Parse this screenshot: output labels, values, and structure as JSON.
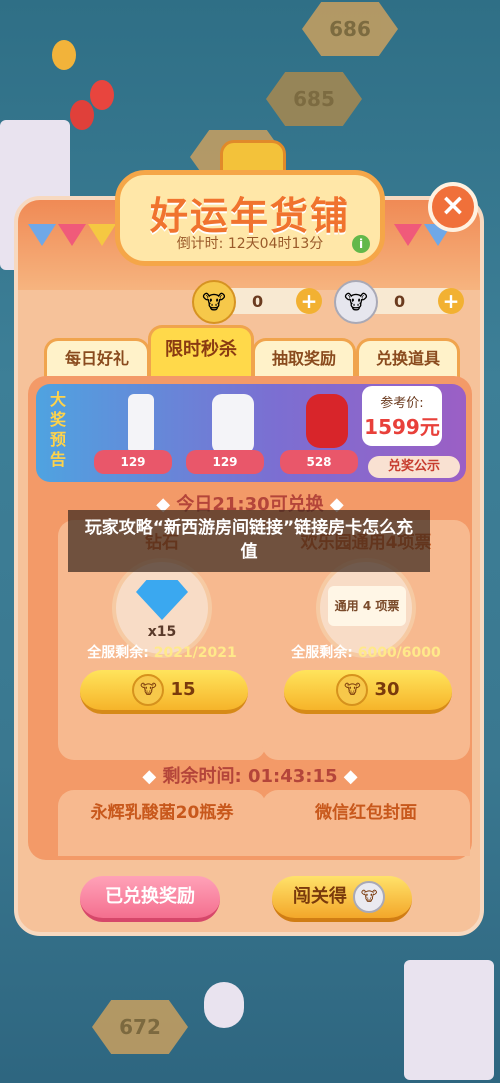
{
  "background": {
    "levels": [
      "686",
      "685",
      "672"
    ]
  },
  "modal": {
    "title": "好运年货铺",
    "countdown": "倒计时: 12天04时13分",
    "info_icon": "i",
    "close_icon": "×"
  },
  "currency": [
    {
      "icon": "cow-coin-gold",
      "value": "0",
      "plus": "+"
    },
    {
      "icon": "cow-coin-silver",
      "value": "0",
      "plus": "+"
    }
  ],
  "tabs": [
    {
      "label": "每日好礼",
      "active": false
    },
    {
      "label": "限时秒杀",
      "active": true
    },
    {
      "label": "抽取奖励",
      "active": false
    },
    {
      "label": "兑换道具",
      "active": false
    }
  ],
  "banner": {
    "side_label": "大奖预告",
    "prizes": [
      {
        "cost": "129"
      },
      {
        "cost": "129"
      },
      {
        "cost": "528"
      }
    ],
    "ref_price_label": "参考价:",
    "ref_price_value": "1599元",
    "notice_button": "兑奖公示"
  },
  "sections": {
    "today": {
      "prefix": "今日",
      "time": "21:30",
      "suffix": "可兑换"
    },
    "remaining": {
      "label": "剩余时间:",
      "time": "01:43:15"
    }
  },
  "cards": [
    {
      "title": "钻石",
      "item_label": "x15",
      "remain_label": "全服剩余:",
      "remain_value": "2021/2021",
      "price": "15"
    },
    {
      "title": "欢乐园通用4项票",
      "item_label": "通用 4 项票",
      "remain_label": "全服剩余:",
      "remain_value": "6000/6000",
      "price": "30"
    },
    {
      "title": "永辉乳酸菌20瓶券"
    },
    {
      "title": "微信红包封面"
    }
  ],
  "bottom": {
    "redeemed_button": "已兑换奖励",
    "play_button": "闯关得"
  },
  "overlay_text": "玩家攻略“新西游房间链接”链接房卡怎么充值",
  "colors": {
    "accent": "#f0732e",
    "modal_bg": "#f6c29a",
    "gold": "#ffd94a",
    "pink": "#f46f8f"
  }
}
